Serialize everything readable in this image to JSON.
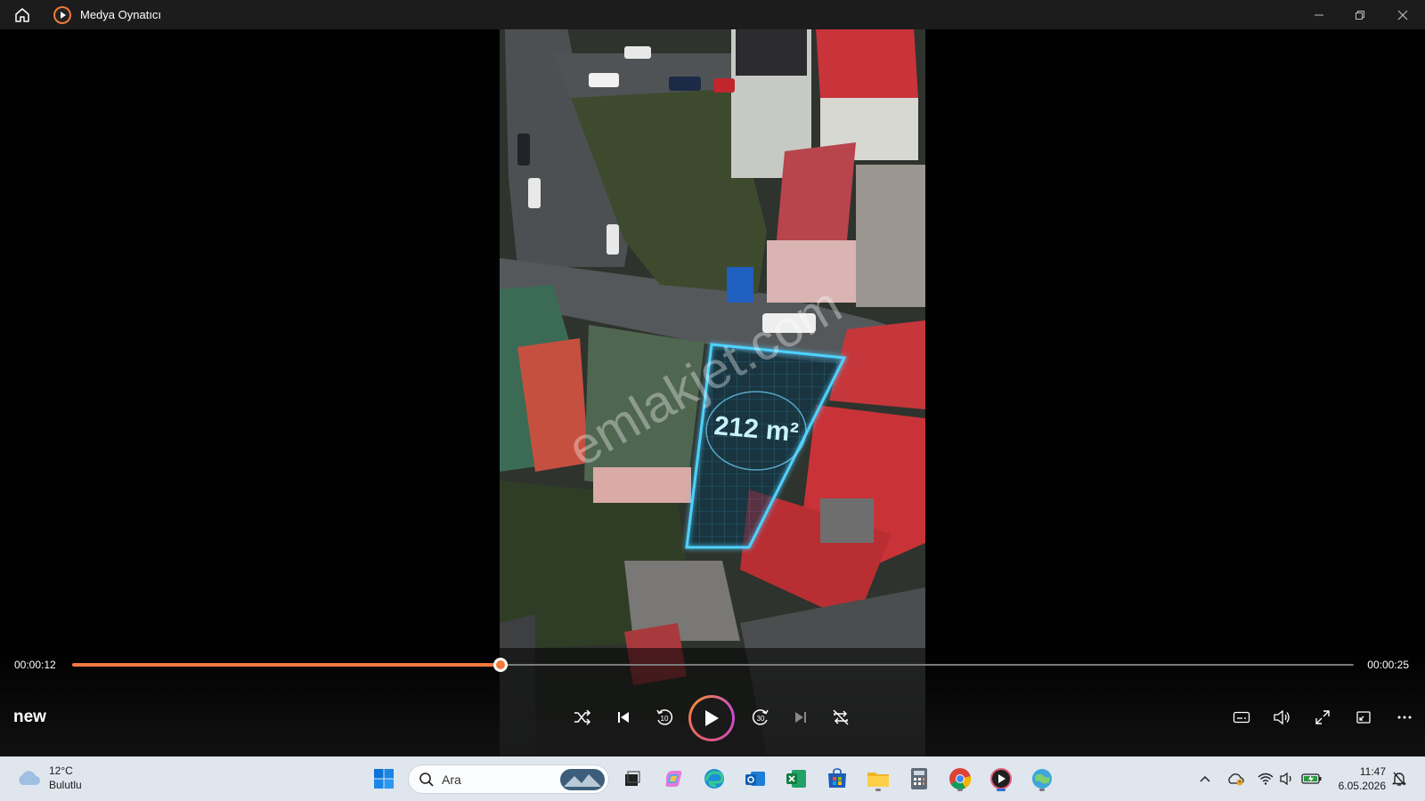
{
  "window": {
    "title": "Medya Oynatıcı"
  },
  "player": {
    "elapsed": "00:00:12",
    "duration": "00:00:25",
    "progress_fraction": 0.334,
    "media_title": "new",
    "accent": "#f07a3c"
  },
  "video_overlay": {
    "area_label": "212 m²",
    "watermark": "emlakjet.com"
  },
  "taskbar": {
    "weather_temp": "12°C",
    "weather_desc": "Bulutlu",
    "search_placeholder": "Ara",
    "time": "11:47",
    "date": "6.05.2026",
    "apps": [
      "windows-start-icon",
      "search-icon",
      "task-view-icon",
      "copilot-icon",
      "edge-icon",
      "outlook-icon",
      "excel-icon",
      "store-icon",
      "file-explorer-icon",
      "calculator-icon",
      "chrome-icon",
      "media-player-icon",
      "app-icon"
    ]
  },
  "colors": {
    "titlebar": "#1c1c1c",
    "taskbar": "#dfe6ee",
    "outline": "#4fd1ff"
  }
}
